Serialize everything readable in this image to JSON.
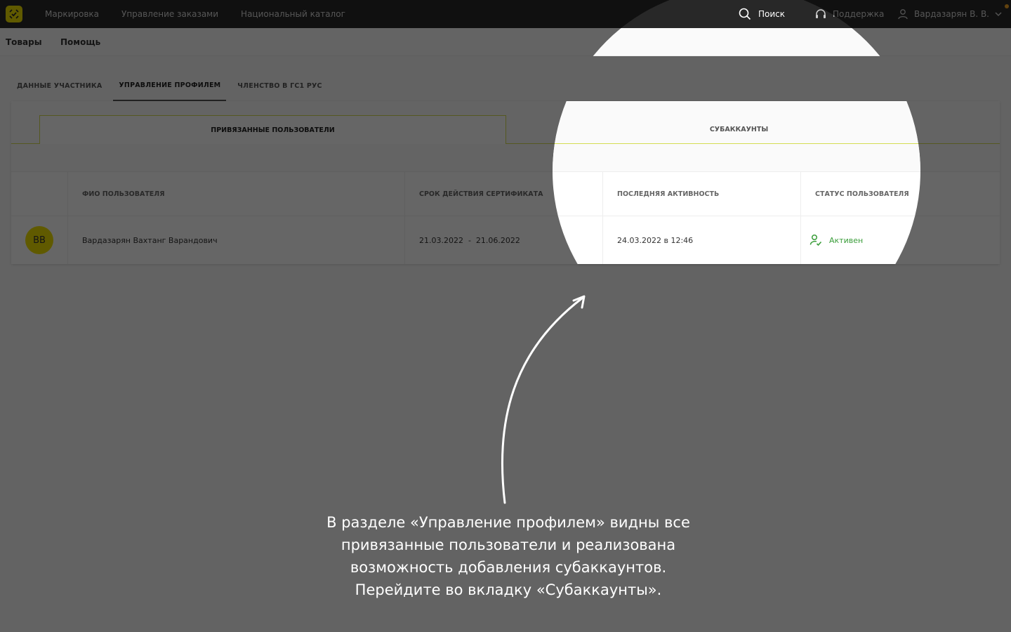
{
  "topbar": {
    "nav": [
      "Маркировка",
      "Управление заказами",
      "Национальный каталог"
    ],
    "search_label": "Поиск",
    "support_label": "Поддержка",
    "user_name": "Вардазарян В. В."
  },
  "subbar": {
    "items": [
      "Товары",
      "Помощь"
    ]
  },
  "main_tabs": [
    {
      "label": "ДАННЫЕ УЧАСТНИКА"
    },
    {
      "label": "УПРАВЛЕНИЕ ПРОФИЛЕМ"
    },
    {
      "label": "ЧЛЕНСТВО В ГС1 РУС"
    }
  ],
  "sub_tabs": [
    {
      "label": "ПРИВЯЗАННЫЕ ПОЛЬЗОВАТЕЛИ"
    },
    {
      "label": "СУБАККАУНТЫ"
    }
  ],
  "table": {
    "headers": [
      "ФИО ПОЛЬЗОВАТЕЛЯ",
      "СРОК ДЕЙСТВИЯ СЕРТИФИКАТА",
      "ПОСЛЕДНЯЯ АКТИВНОСТЬ",
      "СТАТУС ПОЛЬЗОВАТЕЛЯ"
    ],
    "rows": [
      {
        "initials": "ВВ",
        "name": "Вардазарян Вахтанг Варандович",
        "cert": "21.03.2022  -  21.06.2022",
        "last_activity": "24.03.2022 в 12:46",
        "status": "Активен"
      }
    ]
  },
  "caption": {
    "lines": [
      "В разделе «Управление профилем» видны все",
      "привязанные пользователи и реализована",
      "возможность добавления субаккаунтов.",
      "Перейдите во вкладку «Субаккаунты»."
    ]
  },
  "colors": {
    "topbar": "#282828",
    "brand_yellow": "#f0e100",
    "active_green": "#3a9d3a",
    "tab_border": "#d4dc52",
    "dim_overlay": "rgba(0,0,0,0.6)"
  }
}
